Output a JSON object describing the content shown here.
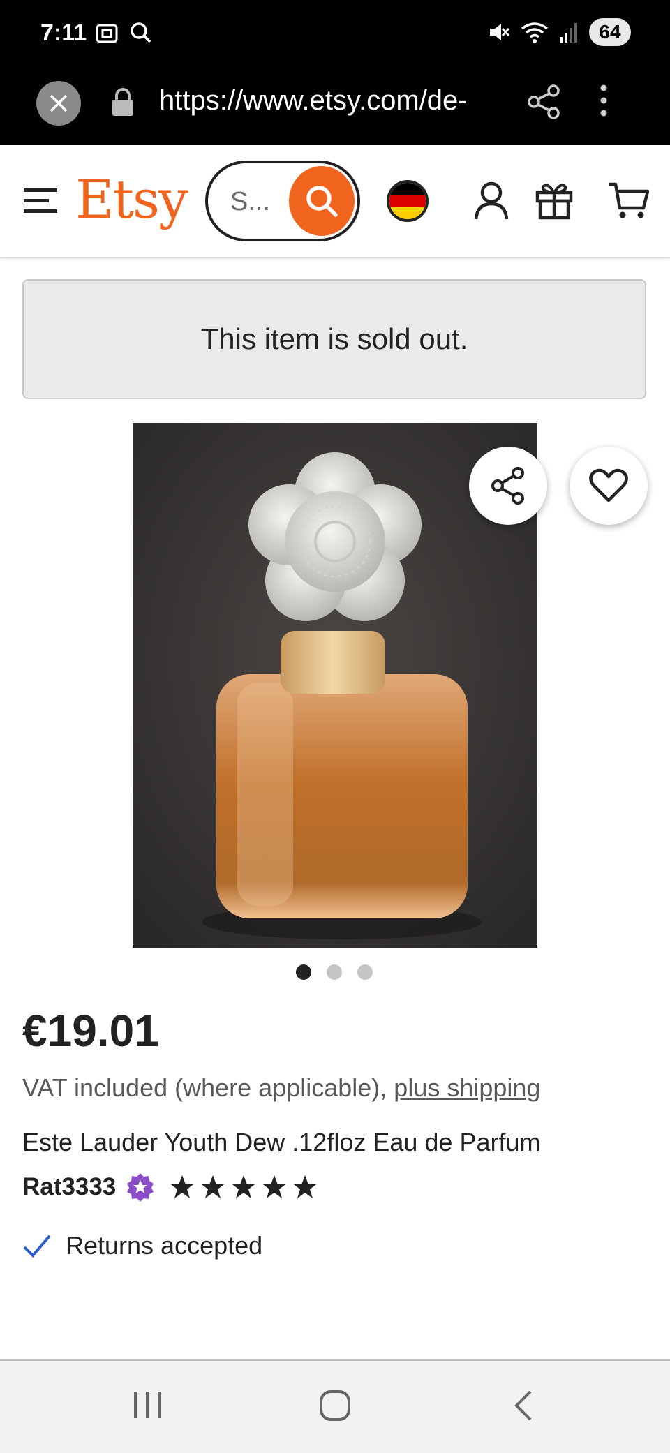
{
  "status_bar": {
    "time": "7:11",
    "battery": "64",
    "icons": [
      "screenshot-icon",
      "search-icon",
      "mute-icon",
      "wifi-icon",
      "signal-icon"
    ]
  },
  "browser": {
    "url": "https://www.etsy.com/de-"
  },
  "header": {
    "logo": "Etsy",
    "search_placeholder": "S..."
  },
  "banner": {
    "sold_out": "This item is sold out."
  },
  "gallery": {
    "image_count": 3,
    "active_index": 0
  },
  "product": {
    "price": "€19.01",
    "vat_text": "VAT included (where applicable), ",
    "shipping_link": "plus shipping",
    "title": "Este Lauder Youth Dew .12floz Eau de Parfum",
    "seller": "Rat3333",
    "rating": 5,
    "returns": "Returns accepted"
  },
  "colors": {
    "accent": "#f1641e",
    "check": "#2f5fd0",
    "star_seller_badge": "#8a4fc7"
  }
}
